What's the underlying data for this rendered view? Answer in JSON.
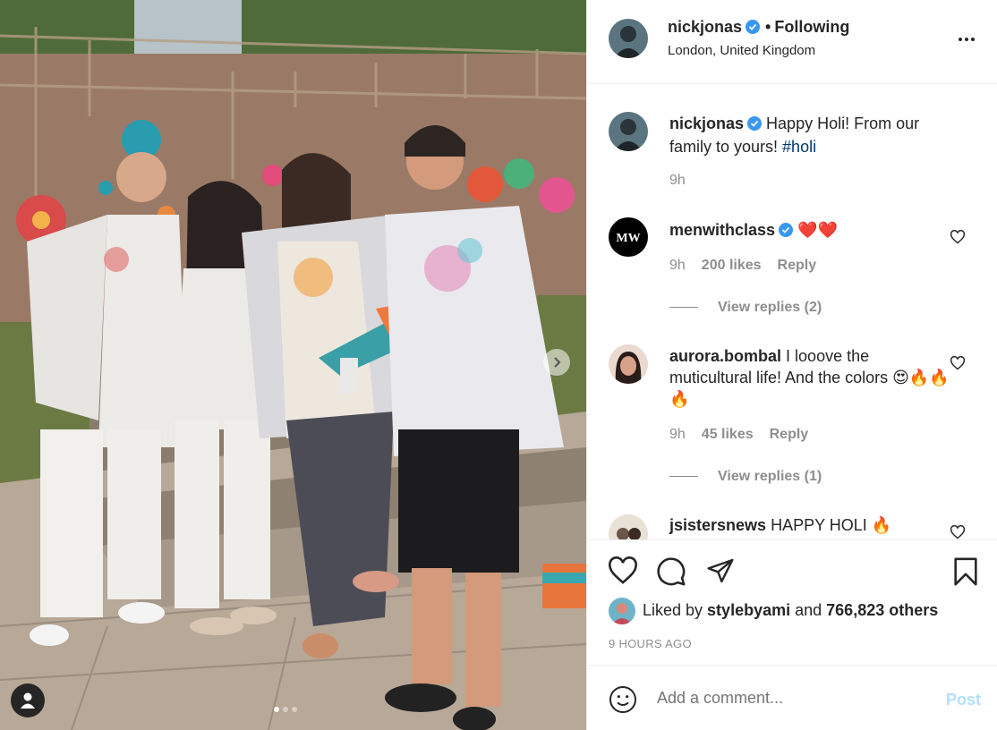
{
  "post": {
    "username": "nickjonas",
    "follow_state": "Following",
    "separator": "•",
    "location": "London, United Kingdom",
    "caption_user": "nickjonas",
    "caption_text": "Happy Holi! From our family to yours! ",
    "caption_hashtag": "#holi",
    "caption_time": "9h"
  },
  "comments": [
    {
      "user": "menwithclass",
      "text": "❤️❤️",
      "time": "9h",
      "likes": "200 likes",
      "reply": "Reply",
      "view_replies": "View replies (2)",
      "avatar_text": "MW"
    },
    {
      "user": "aurora.bombal",
      "text": "I looove the muticultural life! And the colors 😍🔥🔥🔥",
      "time": "9h",
      "likes": "45 likes",
      "reply": "Reply",
      "view_replies": "View replies (1)"
    },
    {
      "user": "jsistersnews",
      "text": "HAPPY HOLI 🔥"
    }
  ],
  "likes": {
    "prefix": "Liked by ",
    "user": "stylebyami",
    "middle": " and ",
    "count": "766,823 others"
  },
  "timestamp": "9 HOURS AGO",
  "composer": {
    "placeholder": "Add a comment...",
    "post_label": "Post"
  },
  "colors": {
    "verified": "#3897f0",
    "post_disabled": "#b2dffc",
    "secondary_text": "#8e8e8e"
  },
  "icons": [
    "heart-icon",
    "comment-icon",
    "share-icon",
    "bookmark-icon",
    "emoji-icon",
    "more-icon",
    "verified-icon",
    "next-arrow-icon",
    "user-tag-icon"
  ]
}
